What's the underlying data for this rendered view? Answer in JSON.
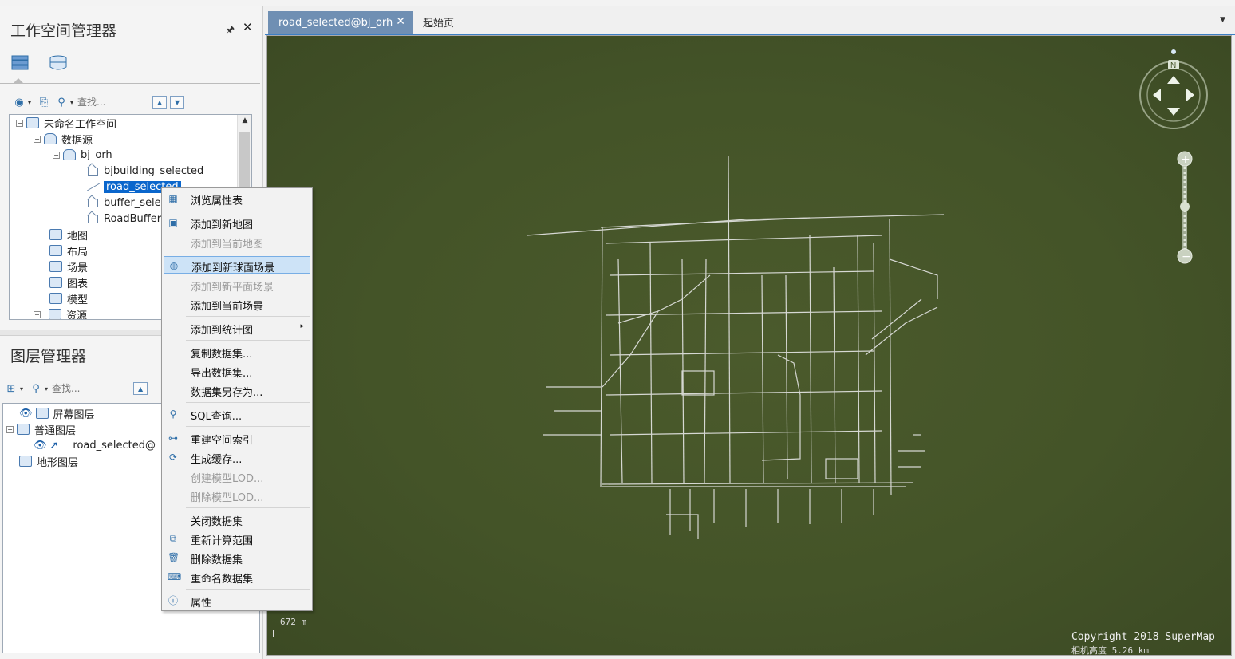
{
  "workspace": {
    "title": "工作空间管理器",
    "pin_glyph": "🖈",
    "close_glyph": "✕",
    "search_placeholder": "查找...",
    "tree": {
      "root": "未命名工作空间",
      "datasource": "数据源",
      "db": "bj_orh",
      "datasets": [
        "bjbuilding_selected",
        "road_selected",
        "buffer_selec",
        "RoadBuffer"
      ],
      "others": [
        "地图",
        "布局",
        "场景",
        "图表",
        "模型",
        "资源"
      ]
    }
  },
  "layers": {
    "title": "图层管理器",
    "search_placeholder": "查找...",
    "screen": "屏幕图层",
    "normal": "普通图层",
    "layer_item": "road_selected@",
    "terrain": "地形图层"
  },
  "tabs": {
    "active": "road_selected@bj_orh",
    "other": "起始页"
  },
  "scene": {
    "scale_label": "672 m",
    "copyright": "Copyright 2018 SuperMap",
    "camera_height": "相机高度 5.26 km",
    "background_color": "#4a582b",
    "road_color": "#e6e6e6"
  },
  "context_menu": {
    "items": [
      {
        "label": "浏览属性表",
        "icon": "table-icon",
        "disabled": false
      },
      {
        "label": "添加到新地图",
        "icon": "add-map-icon",
        "disabled": false
      },
      {
        "label": "添加到当前地图",
        "icon": "",
        "disabled": true
      },
      {
        "label": "添加到新球面场景",
        "icon": "globe-icon",
        "disabled": false,
        "highlighted": true
      },
      {
        "label": "添加到新平面场景",
        "icon": "",
        "disabled": true
      },
      {
        "label": "添加到当前场景",
        "icon": "",
        "disabled": false
      },
      {
        "label": "添加到统计图",
        "icon": "",
        "disabled": false,
        "submenu": true
      },
      {
        "label": "复制数据集...",
        "icon": "",
        "disabled": false
      },
      {
        "label": "导出数据集...",
        "icon": "",
        "disabled": false
      },
      {
        "label": "数据集另存为...",
        "icon": "",
        "disabled": false
      },
      {
        "label": "SQL查询...",
        "icon": "search-icon",
        "disabled": false
      },
      {
        "label": "重建空间索引",
        "icon": "index-icon",
        "disabled": false
      },
      {
        "label": "生成缓存...",
        "icon": "cache-icon",
        "disabled": false
      },
      {
        "label": "创建模型LOD...",
        "icon": "",
        "disabled": true
      },
      {
        "label": "删除模型LOD...",
        "icon": "",
        "disabled": true
      },
      {
        "label": "关闭数据集",
        "icon": "",
        "disabled": false
      },
      {
        "label": "重新计算范围",
        "icon": "recalc-icon",
        "disabled": false
      },
      {
        "label": "删除数据集",
        "icon": "trash-icon",
        "disabled": false
      },
      {
        "label": "重命名数据集",
        "icon": "rename-icon",
        "disabled": false
      },
      {
        "label": "属性",
        "icon": "info-icon",
        "disabled": false
      }
    ],
    "submenu_arrow": "▸"
  }
}
